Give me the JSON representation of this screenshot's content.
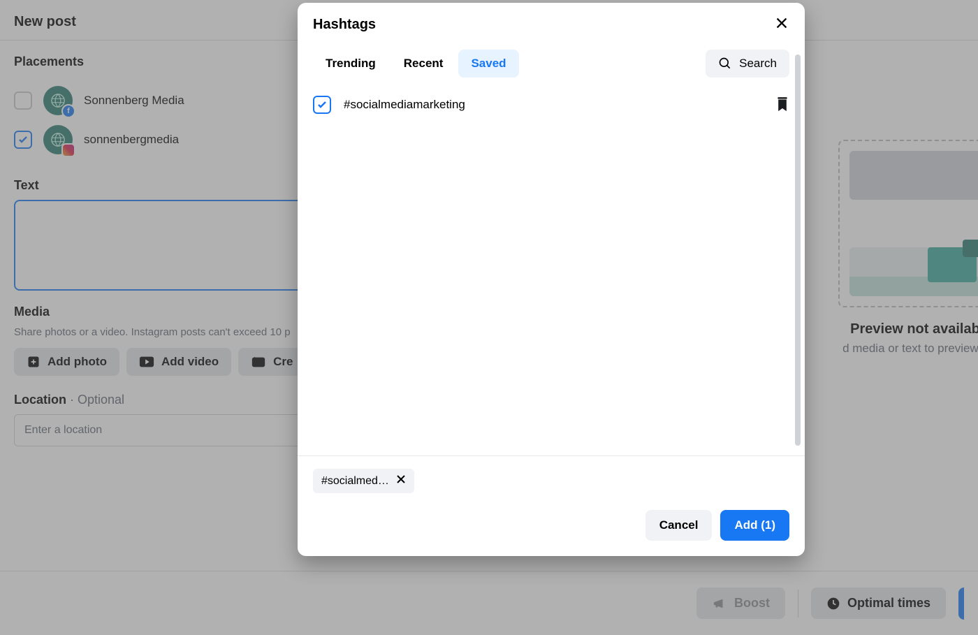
{
  "header": {
    "title": "New post"
  },
  "placements": {
    "label": "Placements",
    "items": [
      {
        "name": "Sonnenberg Media",
        "checked": false,
        "network": "fb"
      },
      {
        "name": "sonnenbergmedia",
        "checked": true,
        "network": "ig"
      }
    ]
  },
  "text": {
    "label": "Text"
  },
  "media": {
    "label": "Media",
    "sub": "Share photos or a video. Instagram posts can't exceed 10 p",
    "add_photo": "Add photo",
    "add_video": "Add video",
    "create": "Cre"
  },
  "location": {
    "label_main": "Location",
    "label_sep": " · ",
    "label_opt": "Optional",
    "placeholder": "Enter a location"
  },
  "preview": {
    "title": "Preview not availab",
    "sub": "d media or text to preview y"
  },
  "footer": {
    "boost": "Boost",
    "optimal": "Optimal times"
  },
  "modal": {
    "title": "Hashtags",
    "tabs": {
      "trending": "Trending",
      "recent": "Recent",
      "saved": "Saved"
    },
    "search": "Search",
    "items": [
      {
        "tag": "#socialmediamarketing",
        "checked": true
      }
    ],
    "chip": "#socialmed…",
    "cancel": "Cancel",
    "add": "Add (1)"
  }
}
